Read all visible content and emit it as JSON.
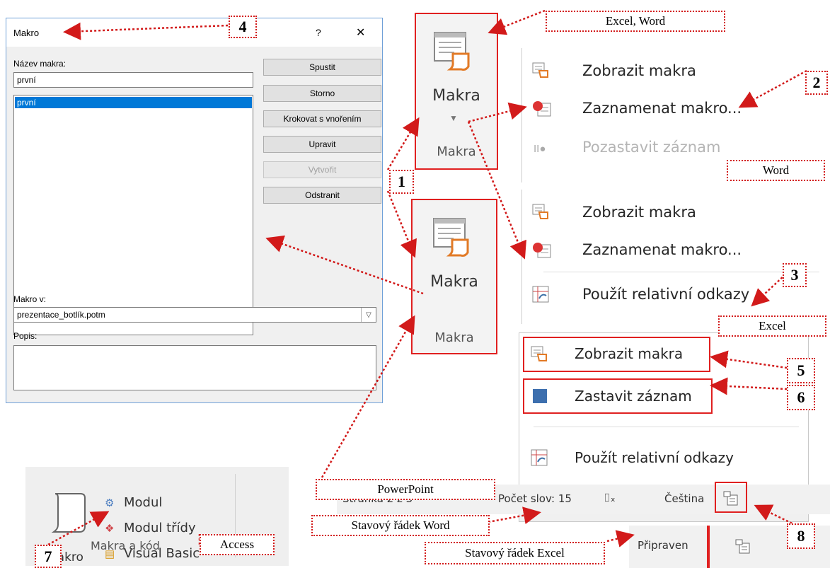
{
  "dialog": {
    "title": "Makro",
    "help_symbol": "?",
    "close_symbol": "✕",
    "name_label": "Název makra:",
    "name_value": "první",
    "list_items": [
      "první"
    ],
    "buttons": [
      "Spustit",
      "Storno",
      "Krokovat s vnořením",
      "Upravit",
      "Vytvořit",
      "Odstranit"
    ],
    "macro_in_label": "Makro v:",
    "macro_in_value": "prezentace_botlík.potm",
    "description_label": "Popis:"
  },
  "ribbon": {
    "excel_word": {
      "button_label": "Makra",
      "group_label": "Makra"
    },
    "powerpoint": {
      "button_label": "Makra",
      "group_label": "Makra"
    }
  },
  "word_menu": {
    "items": [
      "Zobrazit makra",
      "Zaznamenat makro...",
      "Pozastavit záznam"
    ]
  },
  "excel_menu": {
    "items": [
      "Zobrazit makra",
      "Zaznamenat makro...",
      "Použít relativní odkazy"
    ]
  },
  "excel_menu_recording": {
    "items": [
      "Zobrazit makra",
      "Zastavit záznam",
      "Použít relativní odkazy"
    ]
  },
  "access": {
    "makro_label": "Makro",
    "modul": "Modul",
    "modul_tridy": "Modul třídy",
    "visual_basic": "Visual Basic",
    "group_label": "Makra a kód"
  },
  "word_status": {
    "page": "Stránka 2 z 3",
    "words": "Počet slov: 15",
    "language": "Čeština"
  },
  "excel_status": {
    "ready": "Připraven"
  },
  "callouts": {
    "excel_word": "Excel, Word",
    "word": "Word",
    "excel": "Excel",
    "powerpoint": "PowerPoint",
    "access": "Access",
    "word_statusbar": "Stavový řádek Word",
    "excel_statusbar": "Stavový řádek Excel",
    "n1": "1",
    "n2": "2",
    "n3": "3",
    "n4": "4",
    "n5": "5",
    "n6": "6",
    "n7": "7",
    "n8": "8"
  },
  "colors": {
    "annotation": "#d21a1a",
    "selection": "#0078d7",
    "stop_square": "#3d6fae"
  }
}
